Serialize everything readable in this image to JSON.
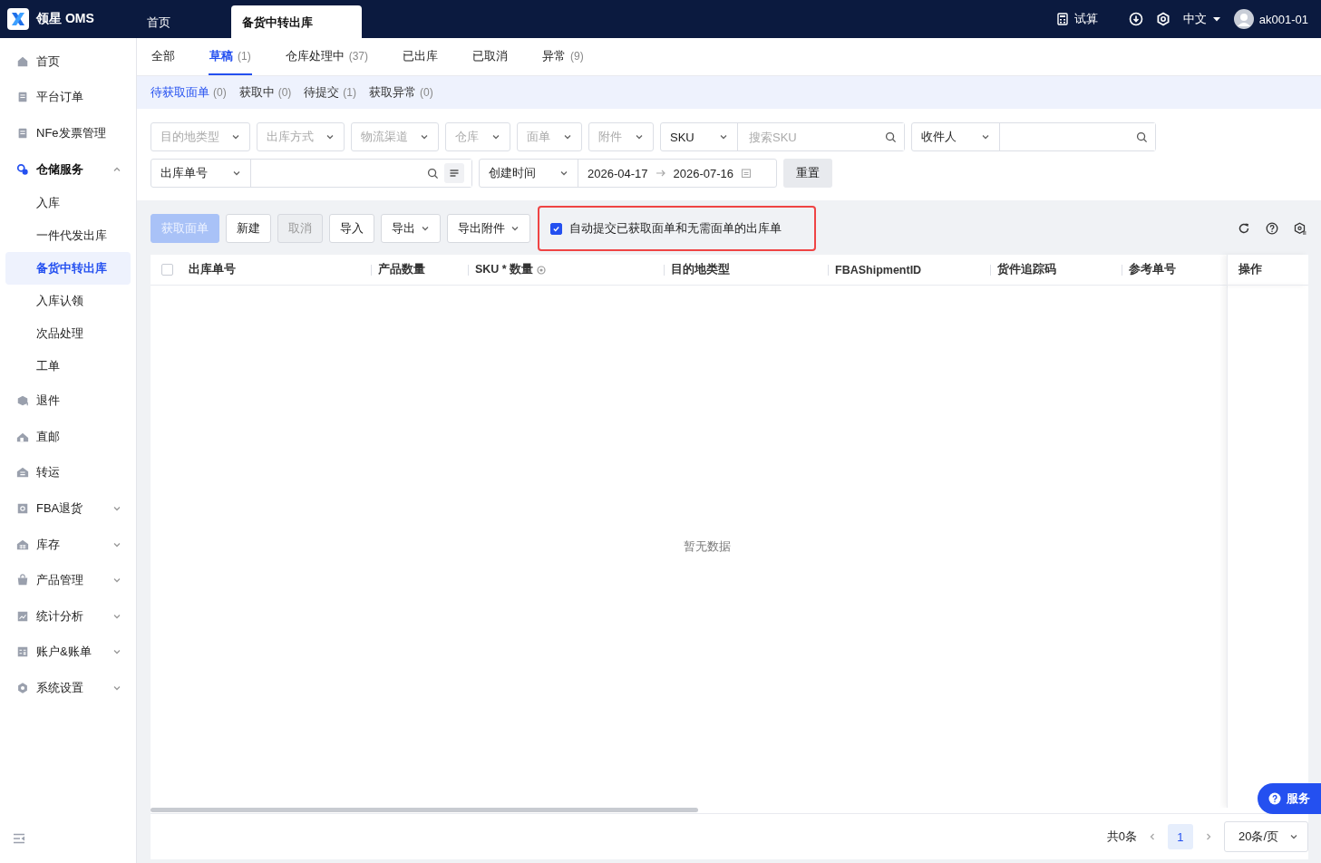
{
  "app": {
    "logo_text": "领星 OMS"
  },
  "page_tabs": [
    {
      "label": "首页",
      "selected": false
    },
    {
      "label": "备货中转出库",
      "selected": true
    }
  ],
  "header": {
    "trial": "试算",
    "language": "中文",
    "user": "ak001-01"
  },
  "sidebar": {
    "items": [
      {
        "label": "首页",
        "selected": false
      },
      {
        "label": "平台订单",
        "selected": false
      },
      {
        "label": "NFe发票管理",
        "selected": false
      },
      {
        "label": "仓储服务",
        "expanded": true,
        "children": [
          {
            "label": "入库",
            "selected": false
          },
          {
            "label": "一件代发出库",
            "selected": false
          },
          {
            "label": "备货中转出库",
            "selected": true
          },
          {
            "label": "入库认领",
            "selected": false
          },
          {
            "label": "次品处理",
            "selected": false
          },
          {
            "label": "工单",
            "selected": false
          }
        ]
      },
      {
        "label": "退件",
        "selected": false
      },
      {
        "label": "直邮",
        "selected": false
      },
      {
        "label": "转运",
        "selected": false
      },
      {
        "label": "FBA退货",
        "expanded": false
      },
      {
        "label": "库存",
        "expanded": false
      },
      {
        "label": "产品管理",
        "expanded": false
      },
      {
        "label": "统计分析",
        "expanded": false
      },
      {
        "label": "账户&账单",
        "expanded": false
      },
      {
        "label": "系统设置",
        "expanded": false
      }
    ]
  },
  "status_tabs": [
    {
      "label": "全部",
      "selected": false
    },
    {
      "label": "草稿",
      "count": "(1)",
      "selected": true
    },
    {
      "label": "仓库处理中",
      "count": "(37)",
      "selected": false
    },
    {
      "label": "已出库",
      "selected": false
    },
    {
      "label": "已取消",
      "selected": false
    },
    {
      "label": "异常",
      "count": "(9)",
      "selected": false
    }
  ],
  "sub_tabs": [
    {
      "label": "待获取面单",
      "count": "(0)",
      "selected": true
    },
    {
      "label": "获取中",
      "count": "(0)",
      "selected": false
    },
    {
      "label": "待提交",
      "count": "(1)",
      "selected": false
    },
    {
      "label": "获取异常",
      "count": "(0)",
      "selected": false
    }
  ],
  "filters": {
    "dropdowns": [
      {
        "placeholder": "目的地类型"
      },
      {
        "placeholder": "出库方式"
      },
      {
        "placeholder": "物流渠道"
      },
      {
        "placeholder": "仓库"
      },
      {
        "placeholder": "面单"
      },
      {
        "placeholder": "附件"
      }
    ],
    "sku": {
      "type": "SKU",
      "placeholder": "搜索SKU"
    },
    "recipient": {
      "type": "收件人"
    },
    "order_no": {
      "type": "出库单号"
    },
    "date": {
      "type": "创建时间",
      "start": "2026-04-17",
      "end": "2026-07-16"
    },
    "reset": "重置"
  },
  "toolbar": {
    "buttons": [
      {
        "label": "获取面单",
        "kind": "primary",
        "disabled": true,
        "dropdown": false
      },
      {
        "label": "新建",
        "kind": "default",
        "disabled": false,
        "dropdown": false
      },
      {
        "label": "取消",
        "kind": "default",
        "disabled": true,
        "dropdown": false
      },
      {
        "label": "导入",
        "kind": "default",
        "disabled": false,
        "dropdown": false
      },
      {
        "label": "导出",
        "kind": "default",
        "disabled": false,
        "dropdown": true
      },
      {
        "label": "导出附件",
        "kind": "default",
        "disabled": false,
        "dropdown": true
      }
    ],
    "auto_submit": {
      "label": "自动提交已获取面单和无需面单的出库单",
      "checked": true,
      "highlighted": true
    }
  },
  "table": {
    "select_all": {
      "checked": false
    },
    "columns": [
      "出库单号",
      "产品数量",
      "SKU * 数量",
      "目的地类型",
      "FBAShipmentID",
      "货件追踪码",
      "参考单号",
      "操作"
    ],
    "empty_text": "暂无数据"
  },
  "pagination": {
    "total": "共0条",
    "pages": [
      {
        "label": "1",
        "selected": true
      }
    ],
    "page_size": "20条/页"
  },
  "service_button": {
    "label": "服务"
  }
}
